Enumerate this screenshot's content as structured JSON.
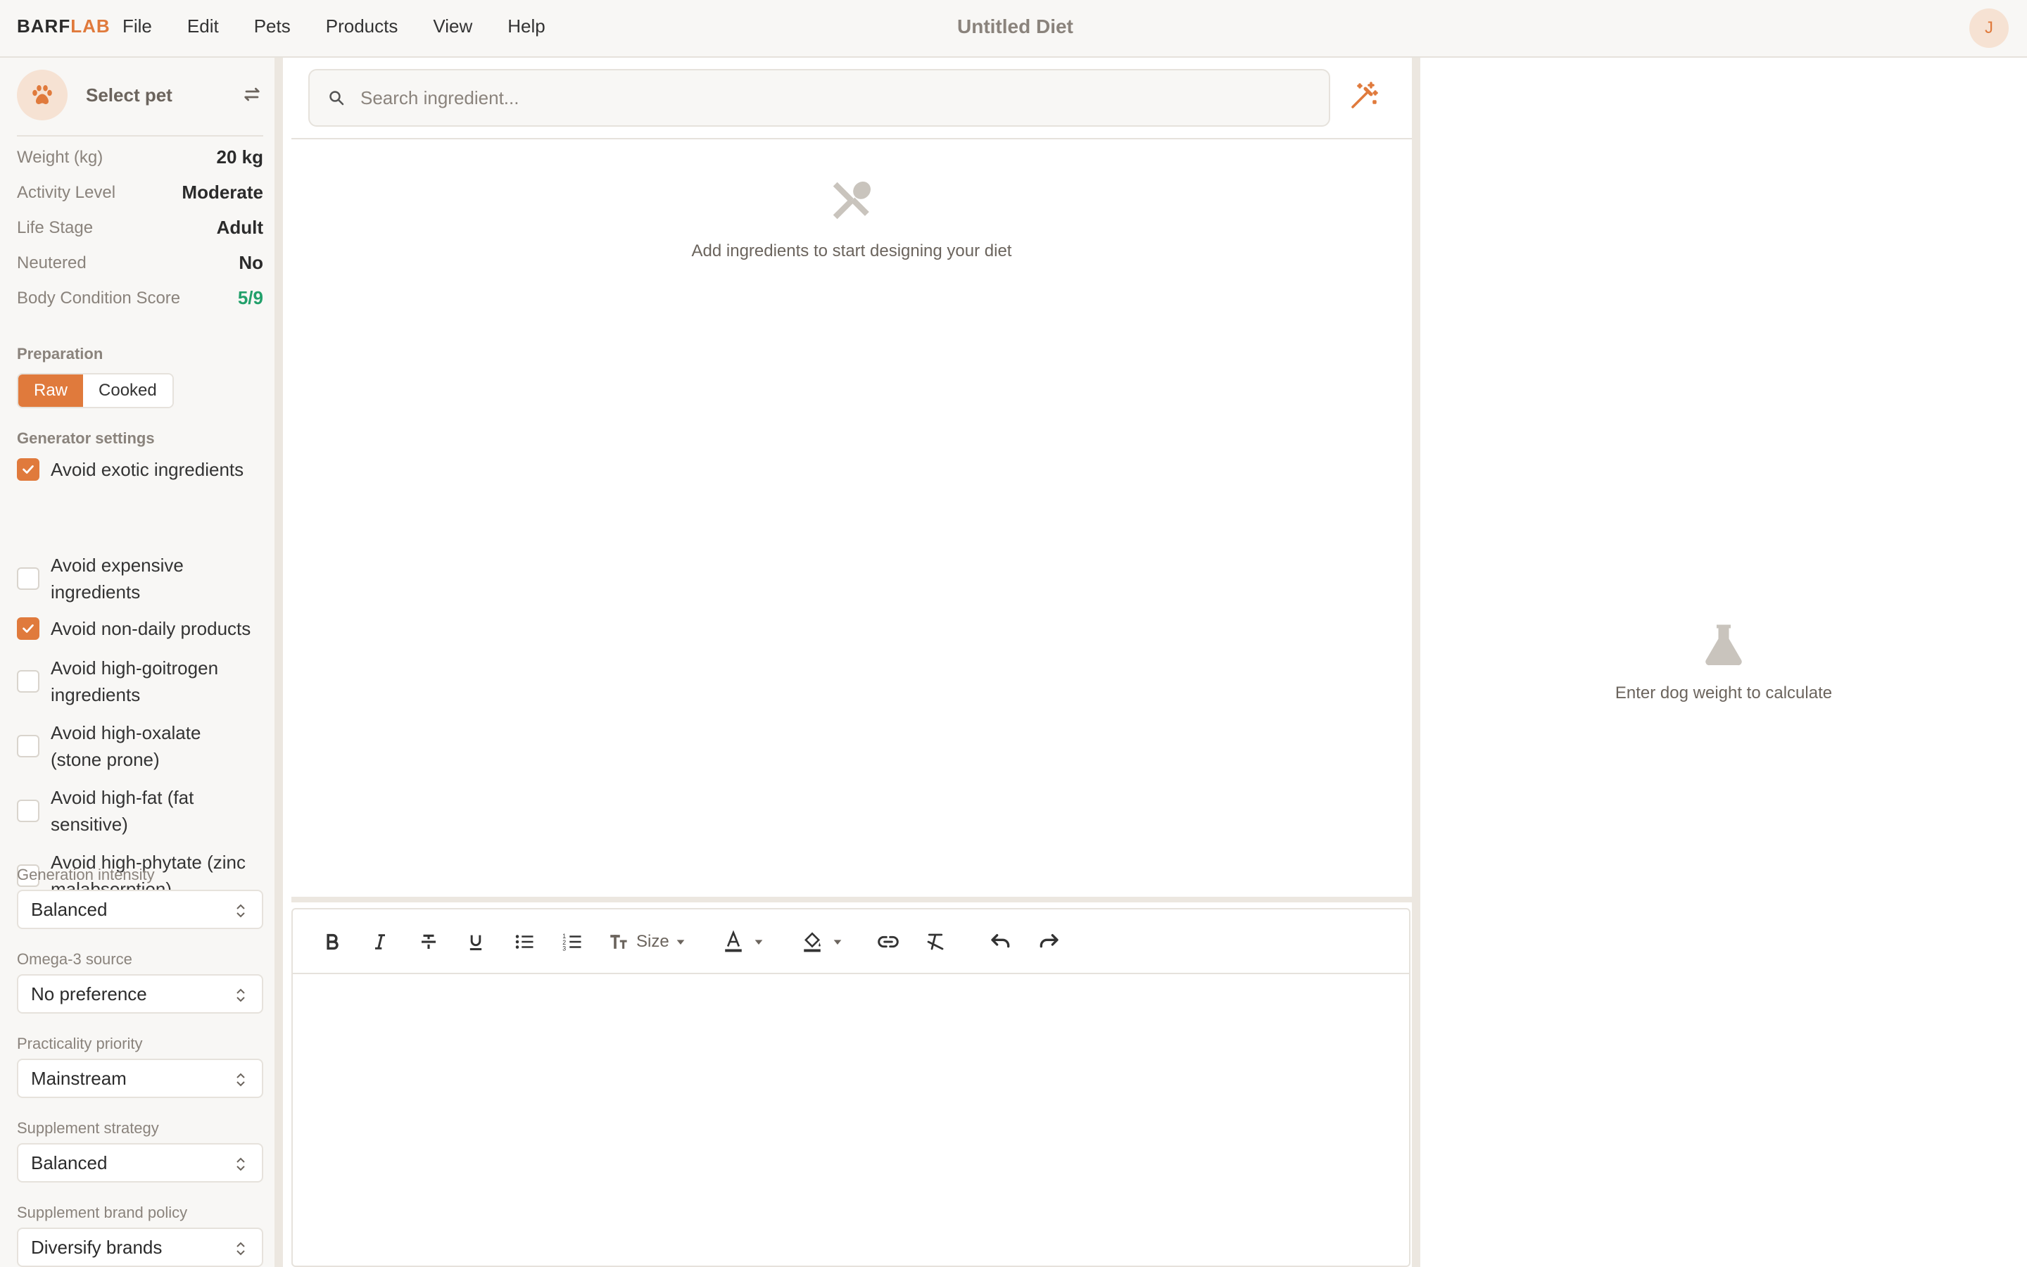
{
  "app": {
    "brand_part1": "BARF",
    "brand_part2": "LAB",
    "title": "Untitled Diet",
    "user_initial": "J",
    "accent_color": "#e07a3c"
  },
  "menu": [
    "File",
    "Edit",
    "Pets",
    "Products",
    "View",
    "Help"
  ],
  "sidebar": {
    "pet_select_label": "Select pet",
    "stats": [
      {
        "label": "Weight (kg)",
        "value": "20 kg"
      },
      {
        "label": "Activity Level",
        "value": "Moderate"
      },
      {
        "label": "Life Stage",
        "value": "Adult"
      },
      {
        "label": "Neutered",
        "value": "No"
      },
      {
        "label": "Body Condition Score",
        "value": "5/9"
      }
    ],
    "preparation_label": "Preparation",
    "preparation_options": {
      "raw": "Raw",
      "cooked": "Cooked"
    },
    "preparation_selected": "Raw",
    "generator_label": "Generator settings",
    "generator_options": [
      {
        "line1": "Avoid exotic ingredients",
        "line2": "",
        "checked": true
      },
      {
        "line1": "Avoid expensive",
        "line2": "ingredients",
        "checked": false
      },
      {
        "line1": "Avoid non-daily products",
        "line2": "",
        "checked": true
      },
      {
        "line1": "Avoid high-goitrogen",
        "line2": "ingredients",
        "checked": false
      },
      {
        "line1": "Avoid high-oxalate",
        "line2": "(stone prone)",
        "checked": false
      },
      {
        "line1": "Avoid high-fat (fat",
        "line2": "sensitive)",
        "checked": false
      },
      {
        "line1": "Avoid high-phytate (zinc",
        "line2": "malabsorption)",
        "checked": false
      }
    ],
    "selects": [
      {
        "label": "Generation intensity",
        "value": "Balanced"
      },
      {
        "label": "Omega-3 source",
        "value": "No preference"
      },
      {
        "label": "Practicality priority",
        "value": "Mainstream"
      },
      {
        "label": "Supplement strategy",
        "value": "Balanced"
      },
      {
        "label": "Supplement brand policy",
        "value": "Diversify brands"
      }
    ]
  },
  "main": {
    "search_placeholder": "Search ingredient...",
    "empty_message": "Add ingredients to start designing your diet",
    "editor_size_label": "Size"
  },
  "right": {
    "empty_message": "Enter dog weight to calculate"
  }
}
